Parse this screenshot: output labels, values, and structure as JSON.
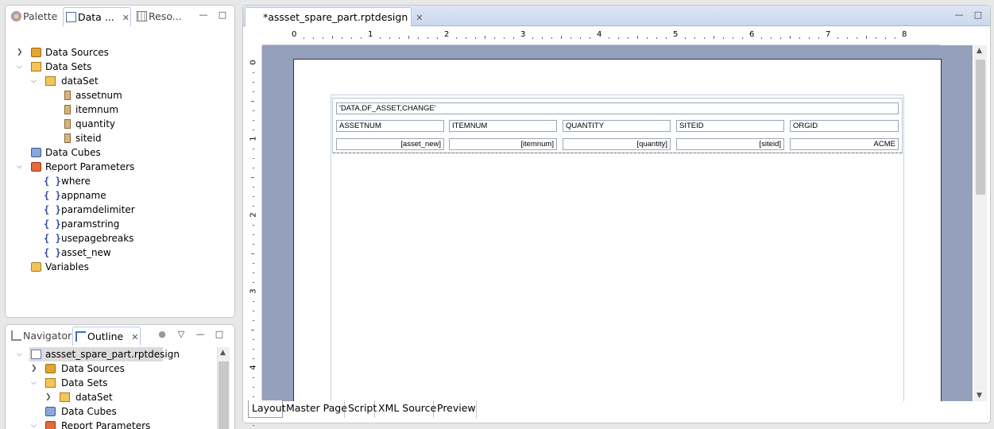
{
  "data_panel": {
    "tabs": [
      {
        "label": "Palette",
        "icon": "palette-icon"
      },
      {
        "label": "Data ...",
        "icon": "data-explorer-icon",
        "close": "✕"
      },
      {
        "label": "Reso...",
        "icon": "resource-icon"
      }
    ],
    "window_buttons": [
      "—",
      "□"
    ],
    "tree": {
      "data_sources": "Data Sources",
      "data_sets": "Data Sets",
      "dataset": "dataSet",
      "columns": [
        "assetnum",
        "itemnum",
        "quantity",
        "siteid"
      ],
      "data_cubes": "Data Cubes",
      "report_parameters": "Report Parameters",
      "parameters": [
        "where",
        "appname",
        "paramdelimiter",
        "paramstring",
        "usepagebreaks",
        "asset_new"
      ],
      "variables": "Variables",
      "braces": "{ }"
    }
  },
  "outline_panel": {
    "tabs": [
      {
        "label": "Navigator",
        "icon": "navigator-icon"
      },
      {
        "label": "Outline",
        "icon": "outline-icon",
        "close": "✕"
      }
    ],
    "window_buttons": [
      "▽",
      "—",
      "□"
    ],
    "tree": {
      "root": "assset_spare_part.rptdesign",
      "data_sources": "Data Sources",
      "data_sets": "Data Sets",
      "dataset": "dataSet",
      "data_cubes": "Data Cubes",
      "report_parameters": "Report Parameters"
    }
  },
  "editor": {
    "tab_label": "*assset_spare_part.rptdesign",
    "tab_close": "✕",
    "window_buttons": [
      "—",
      "□"
    ],
    "ruler_h_numbers": [
      "0",
      "1",
      "2",
      "3",
      "4",
      "5",
      "6",
      "7",
      "8"
    ],
    "ruler_v_numbers": [
      "0",
      "1",
      "2",
      "3",
      "4"
    ],
    "report": {
      "title_cell": "'DATA,DF_ASSET,CHANGE'",
      "headers": [
        "ASSETNUM",
        "ITEMNUM",
        "QUANTITY",
        "SITEID",
        "ORGID"
      ],
      "details": [
        "[asset_new]",
        "[itemnum]",
        "[quantity]",
        "[siteid]",
        "ACME"
      ]
    },
    "bottom_tabs": [
      "Layout",
      "Master Page",
      "Script",
      "XML Source",
      "Preview"
    ],
    "active_bottom_tab": "Layout"
  }
}
